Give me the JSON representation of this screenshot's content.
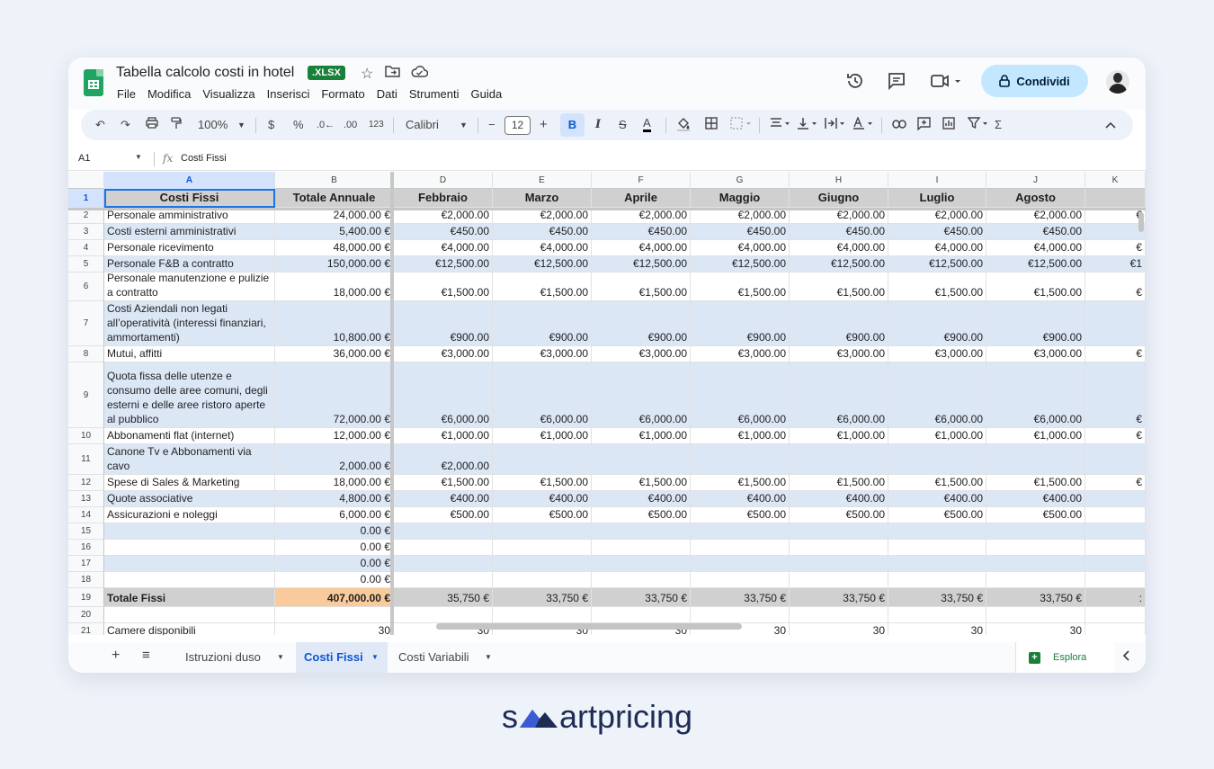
{
  "app": {
    "doc_title": "Tabella calcolo costi in hotel",
    "file_badge": ".XLSX",
    "menu": [
      "File",
      "Modifica",
      "Visualizza",
      "Inserisci",
      "Formato",
      "Dati",
      "Strumenti",
      "Guida"
    ],
    "share_label": "Condividi"
  },
  "toolbar": {
    "zoom": "100%",
    "currency": "$",
    "percent": "%",
    "decrease_decimals": ".0←",
    "increase_decimals": ".00",
    "number_format": "123",
    "font": "Calibri",
    "font_size": "12",
    "minus": "−",
    "plus": "+",
    "bold": "B",
    "italic": "I",
    "strike": "S",
    "text_color": "A",
    "sum": "Σ"
  },
  "formula_bar": {
    "cell_ref": "A1",
    "fx": "fx",
    "value": "Costi Fissi"
  },
  "columns": [
    "A",
    "B",
    "D",
    "E",
    "F",
    "G",
    "H",
    "I",
    "J",
    "K"
  ],
  "header_row": {
    "num": "1",
    "cells": [
      "Costi Fissi",
      "Totale Annuale",
      "Febbraio",
      "Marzo",
      "Aprile",
      "Maggio",
      "Giugno",
      "Luglio",
      "Agosto",
      ""
    ]
  },
  "rows": [
    {
      "num": "2",
      "a": "Personale amministrativo",
      "b": "24,000.00 €",
      "months": [
        "€2,000.00",
        "€2,000.00",
        "€2,000.00",
        "€2,000.00",
        "€2,000.00",
        "€2,000.00",
        "€2,000.00",
        "€"
      ]
    },
    {
      "num": "3",
      "a": "Costi esterni amministrativi",
      "b": "5,400.00 €",
      "months": [
        "€450.00",
        "€450.00",
        "€450.00",
        "€450.00",
        "€450.00",
        "€450.00",
        "€450.00",
        ""
      ]
    },
    {
      "num": "4",
      "a": "Personale ricevimento",
      "b": "48,000.00 €",
      "months": [
        "€4,000.00",
        "€4,000.00",
        "€4,000.00",
        "€4,000.00",
        "€4,000.00",
        "€4,000.00",
        "€4,000.00",
        "€"
      ]
    },
    {
      "num": "5",
      "a": "Personale F&B a contratto",
      "b": "150,000.00 €",
      "months": [
        "€12,500.00",
        "€12,500.00",
        "€12,500.00",
        "€12,500.00",
        "€12,500.00",
        "€12,500.00",
        "€12,500.00",
        "€1"
      ]
    },
    {
      "num": "6",
      "a": "Personale manutenzione e pulizie a contratto",
      "b": "18,000.00 €",
      "months": [
        "€1,500.00",
        "€1,500.00",
        "€1,500.00",
        "€1,500.00",
        "€1,500.00",
        "€1,500.00",
        "€1,500.00",
        "€"
      ]
    },
    {
      "num": "7",
      "a": "Costi Aziendali non legati all’operatività (interessi finanziari, ammortamenti)",
      "b": "10,800.00 €",
      "months": [
        "€900.00",
        "€900.00",
        "€900.00",
        "€900.00",
        "€900.00",
        "€900.00",
        "€900.00",
        ""
      ]
    },
    {
      "num": "8",
      "a": "Mutui, affitti",
      "b": "36,000.00 €",
      "months": [
        "€3,000.00",
        "€3,000.00",
        "€3,000.00",
        "€3,000.00",
        "€3,000.00",
        "€3,000.00",
        "€3,000.00",
        "€"
      ]
    },
    {
      "num": "9",
      "a": "Quota fissa delle utenze e consumo delle aree comuni, degli esterni e delle aree ristoro aperte al pubblico",
      "b": "72,000.00 €",
      "months": [
        "€6,000.00",
        "€6,000.00",
        "€6,000.00",
        "€6,000.00",
        "€6,000.00",
        "€6,000.00",
        "€6,000.00",
        "€"
      ]
    },
    {
      "num": "10",
      "a": "Abbonamenti flat (internet)",
      "b": "12,000.00 €",
      "months": [
        "€1,000.00",
        "€1,000.00",
        "€1,000.00",
        "€1,000.00",
        "€1,000.00",
        "€1,000.00",
        "€1,000.00",
        "€"
      ]
    },
    {
      "num": "11",
      "a": "Canone Tv e Abbonamenti via cavo",
      "b": "2,000.00 €",
      "months": [
        "€2,000.00",
        "",
        "",
        "",
        "",
        "",
        "",
        ""
      ]
    },
    {
      "num": "12",
      "a": "Spese di Sales & Marketing",
      "b": "18,000.00 €",
      "months": [
        "€1,500.00",
        "€1,500.00",
        "€1,500.00",
        "€1,500.00",
        "€1,500.00",
        "€1,500.00",
        "€1,500.00",
        "€"
      ]
    },
    {
      "num": "13",
      "a": "Quote associative",
      "b": "4,800.00 €",
      "months": [
        "€400.00",
        "€400.00",
        "€400.00",
        "€400.00",
        "€400.00",
        "€400.00",
        "€400.00",
        ""
      ]
    },
    {
      "num": "14",
      "a": "Assicurazioni e noleggi",
      "b": "6,000.00 €",
      "months": [
        "€500.00",
        "€500.00",
        "€500.00",
        "€500.00",
        "€500.00",
        "€500.00",
        "€500.00",
        ""
      ]
    },
    {
      "num": "15",
      "a": "",
      "b": "0.00 €",
      "months": [
        "",
        "",
        "",
        "",
        "",
        "",
        "",
        ""
      ]
    },
    {
      "num": "16",
      "a": "",
      "b": "0.00 €",
      "months": [
        "",
        "",
        "",
        "",
        "",
        "",
        "",
        ""
      ]
    },
    {
      "num": "17",
      "a": "",
      "b": "0.00 €",
      "months": [
        "",
        "",
        "",
        "",
        "",
        "",
        "",
        ""
      ]
    },
    {
      "num": "18",
      "a": "",
      "b": "0.00 €",
      "months": [
        "",
        "",
        "",
        "",
        "",
        "",
        "",
        ""
      ]
    },
    {
      "num": "19",
      "a": "Totale Fissi",
      "b": "407,000.00 €",
      "months": [
        "35,750 €",
        "33,750 €",
        "33,750 €",
        "33,750 €",
        "33,750 €",
        "33,750 €",
        "33,750 €",
        ":"
      ]
    },
    {
      "num": "20",
      "a": "",
      "b": "",
      "months": [
        "",
        "",
        "",
        "",
        "",
        "",
        "",
        ""
      ]
    },
    {
      "num": "21",
      "a": "Camere disponibili",
      "b": "30",
      "months": [
        "30",
        "30",
        "30",
        "30",
        "30",
        "30",
        "30",
        ""
      ]
    }
  ],
  "sheet_tabs": [
    "Istruzioni duso",
    "Costi Fissi",
    "Costi Variabili"
  ],
  "explore_label": "Esplora",
  "brand": {
    "name": "smartpricing",
    "part1": "s",
    "part2": "art",
    "part3": "pricing"
  },
  "colors": {
    "accent": "#1a73e8",
    "share_bg": "#c2e7ff",
    "band": "#dce7f6",
    "header_gray": "#d0d0d0",
    "total_highlight": "#f9cb9c",
    "sheets_green": "#1fa463"
  }
}
